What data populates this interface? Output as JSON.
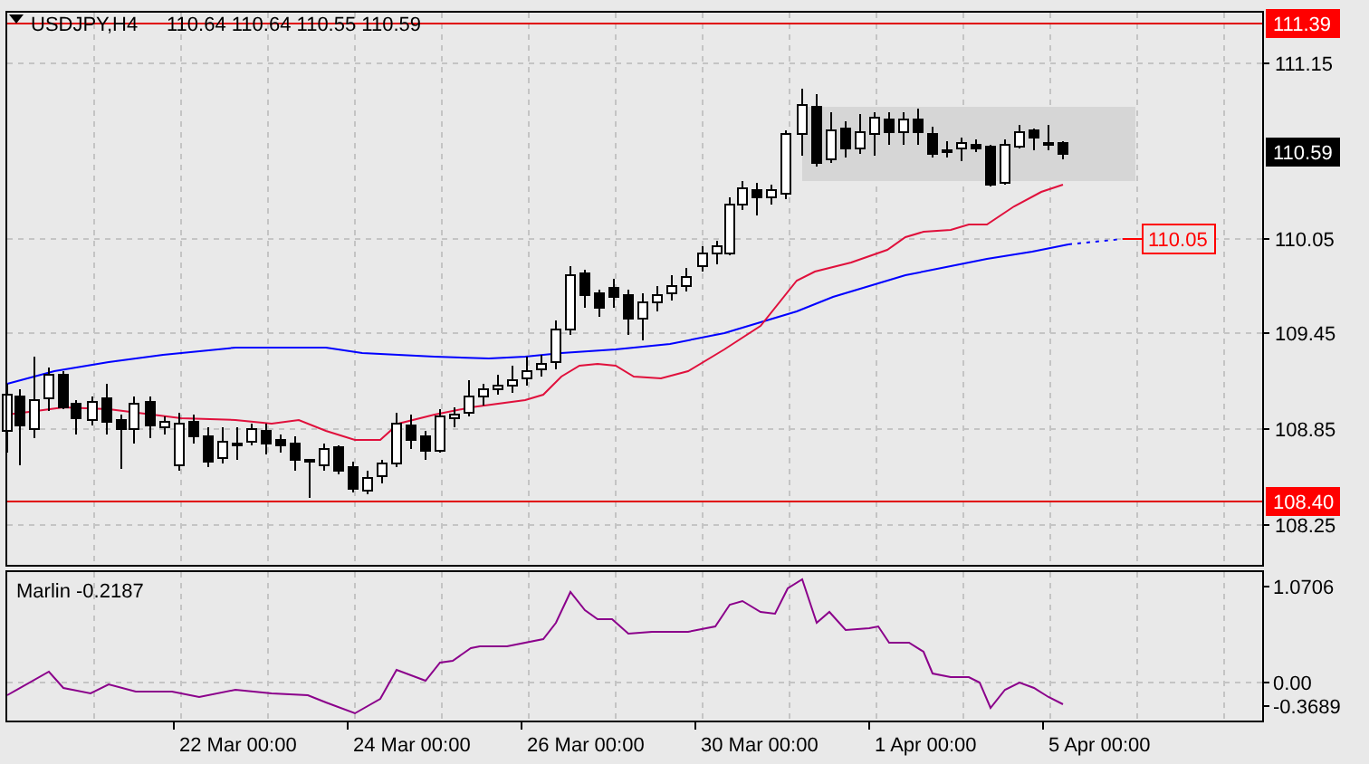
{
  "chart": {
    "symbol": "USDJPY,H4",
    "ohlc": "110.64 110.64 110.55 110.59",
    "price_axis": [
      "111.15",
      "110.05",
      "109.45",
      "108.85",
      "108.25"
    ],
    "price_labels": [
      {
        "text": "111.39",
        "kind": "level_line"
      },
      {
        "text": "110.59",
        "kind": "current_price"
      },
      {
        "text": "110.05",
        "kind": "target"
      },
      {
        "text": "108.40",
        "kind": "level_line"
      }
    ]
  },
  "indicator": {
    "title": "Marlin -0.2187",
    "axis": [
      "1.0706",
      "0.00",
      "-0.3689"
    ]
  },
  "time_axis": [
    "22 Mar 00:00",
    "24 Mar 00:00",
    "26 Mar 00:00",
    "30 Mar 00:00",
    "1 Apr 00:00",
    "5 Apr 00:00"
  ]
}
